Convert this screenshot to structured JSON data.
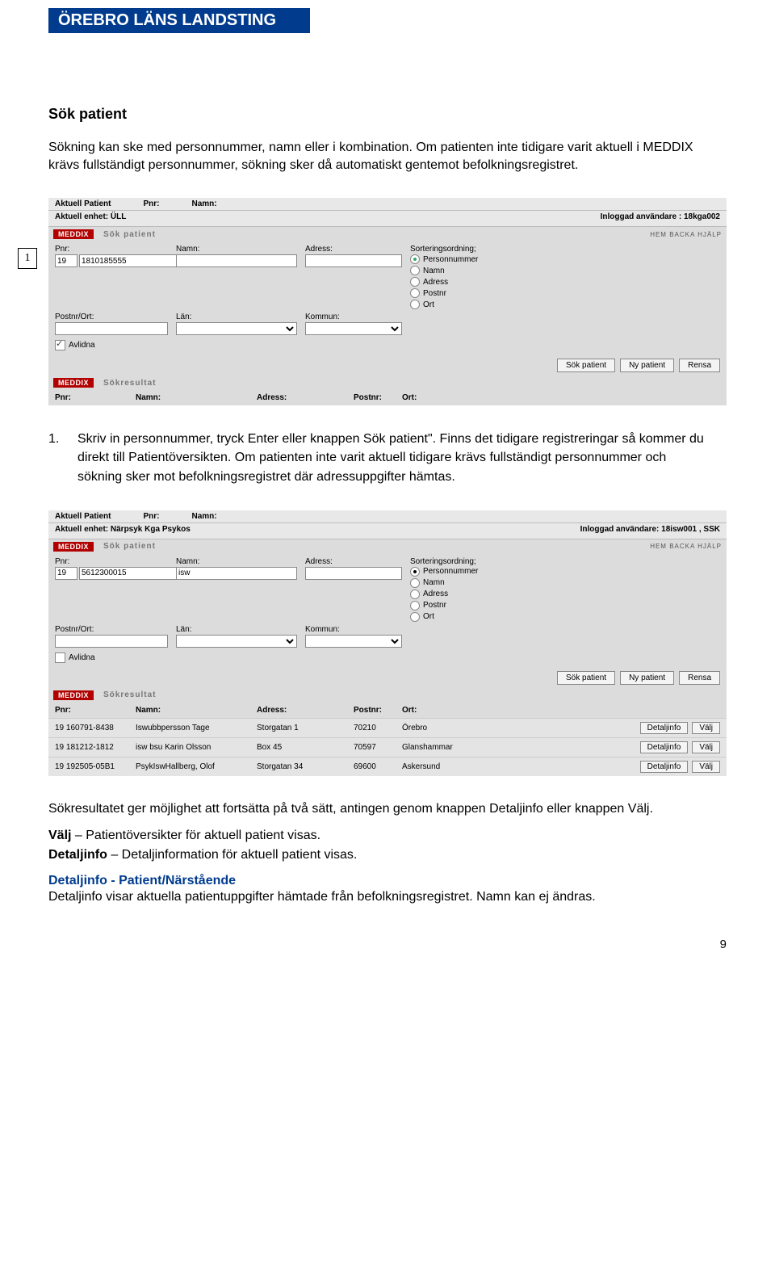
{
  "header": {
    "org": "ÖREBRO LÄNS LANDSTING"
  },
  "heading": "Sök patient",
  "intro": "Sökning kan ske med personnummer, namn eller i kombination. Om patienten inte tidigare varit aktuell i MEDDIX krävs fullständigt personnummer, sökning sker då automatiskt gentemot befolkningsregistret.",
  "callout1": "1",
  "shot1": {
    "row1": {
      "l1": "Aktuell Patient",
      "l2": "Pnr:",
      "l3": "Namn:"
    },
    "row2": {
      "l1": "Aktuell enhet: ÜLL",
      "r": "Inloggad användare : 18kga002"
    },
    "searchbar": {
      "tag": "MEDDIX",
      "title": "Sök patient",
      "links": "HEM BACKA HJÄLP"
    },
    "labels": {
      "pnr": "Pnr:",
      "namn": "Namn:",
      "adr": "Adress:",
      "sort": "Sorteringsordning;",
      "post": "Postnr/Ort:",
      "lan": "Län:",
      "kom": "Kommun:",
      "avl": "Avlidna"
    },
    "vals": {
      "pre": "19",
      "pnr": "1810185555"
    },
    "sortopts": [
      "Personnummer",
      "Namn",
      "Adress",
      "Postnr",
      "Ort"
    ],
    "buttons": {
      "sok": "Sök patient",
      "ny": "Ny patient",
      "rensa": "Rensa"
    },
    "resbar": {
      "tag": "MEDDIX",
      "title": "Sökresultat"
    },
    "reshead": {
      "pnr": "Pnr:",
      "namn": "Namn:",
      "adr": "Adress:",
      "pst": "Postnr:",
      "ort": "Ort:"
    }
  },
  "step1": {
    "n": "1.",
    "txt": "Skriv in personnummer, tryck Enter eller knappen Sök patient\". Finns det tidigare registreringar så kommer du direkt till Patientöversikten. Om patienten inte varit aktuell tidigare krävs fullständigt personnummer och\nsökning sker mot befolkningsregistret där adressuppgifter hämtas."
  },
  "shot2": {
    "row1": {
      "l1": "Aktuell Patient",
      "l2": "Pnr:",
      "l3": "Namn:"
    },
    "row2": {
      "l1": "Aktuell enhet: Närpsyk Kga Psykos",
      "r": "Inloggad användare: 18isw001 , SSK"
    },
    "searchbar": {
      "tag": "MEDDIX",
      "title": "Sök patient",
      "links": "HEM BACKA HJÄLP"
    },
    "labels": {
      "pnr": "Pnr:",
      "namn": "Namn:",
      "adr": "Adress:",
      "sort": "Sorteringsordning;",
      "post": "Postnr/Ort:",
      "lan": "Län:",
      "kom": "Kommun:",
      "avl": "Avlidna"
    },
    "vals": {
      "pre": "19",
      "pnr": "5612300015",
      "namn": "isw"
    },
    "sortopts": [
      "Personnummer",
      "Namn",
      "Adress",
      "Postnr",
      "Ort"
    ],
    "buttons": {
      "sok": "Sök patient",
      "ny": "Ny patient",
      "rensa": "Rensa"
    },
    "resbar": {
      "tag": "MEDDIX",
      "title": "Sökresultat"
    },
    "reshead": {
      "pnr": "Pnr:",
      "namn": "Namn:",
      "adr": "Adress:",
      "pst": "Postnr:",
      "ort": "Ort:"
    },
    "rows": [
      {
        "pnr": "19 160791-8438",
        "namn": "Iswubbpersson Tage",
        "adr": "Storgatan 1",
        "pst": "70210",
        "ort": "Örebro"
      },
      {
        "pnr": "19 181212-1812",
        "namn": "isw bsu Karin Olsson",
        "adr": "Box 45",
        "pst": "70597",
        "ort": "Glanshammar"
      },
      {
        "pnr": "19 192505-05B1",
        "namn": "PsykIswHallberg, Olof",
        "adr": "Storgatan 34",
        "pst": "69600",
        "ort": "Askersund"
      }
    ],
    "rowbtns": {
      "det": "Detaljinfo",
      "valj": "Välj"
    }
  },
  "para2": "Sökresultatet ger möjlighet att fortsätta på två sätt, antingen genom knappen Detaljinfo eller knappen Välj.",
  "para3a": "Välj",
  "para3b": " – Patientöversikter för aktuell patient visas.",
  "para4a": "Detaljinfo",
  "para4b": " – Detaljinformation för aktuell patient visas.",
  "sub": "Detaljinfo - Patient/Närstående",
  "para5": "Detaljinfo visar aktuella patientuppgifter hämtade från befolkningsregistret. Namn kan ej ändras.",
  "pagenum": "9"
}
